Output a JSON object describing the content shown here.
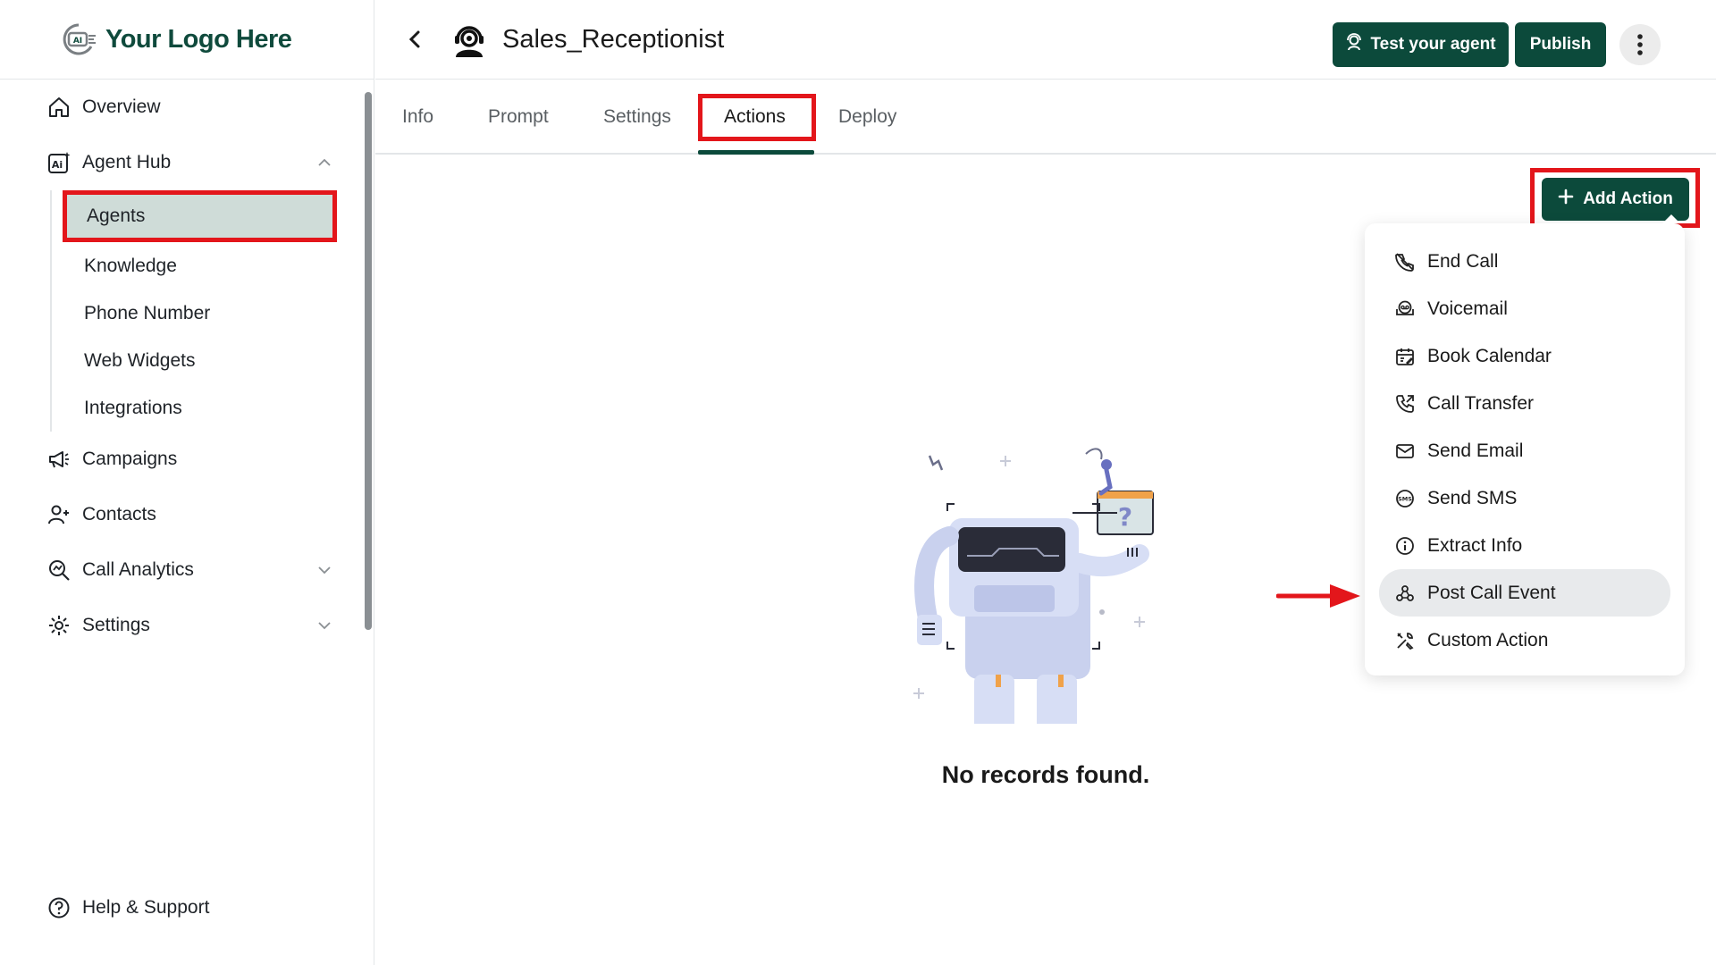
{
  "logo": {
    "text": "Your Logo Here",
    "mark": "AI"
  },
  "sidebar": {
    "items": [
      {
        "label": "Overview",
        "icon": "home-icon"
      },
      {
        "label": "Agent Hub",
        "icon": "ai-spark-icon"
      },
      {
        "label": "Campaigns",
        "icon": "megaphone-icon"
      },
      {
        "label": "Contacts",
        "icon": "user-plus-icon"
      },
      {
        "label": "Call Analytics",
        "icon": "analytics-icon"
      },
      {
        "label": "Settings",
        "icon": "settings-icon"
      }
    ],
    "agent_hub_sub": [
      "Agents",
      "Knowledge",
      "Phone Number",
      "Web Widgets",
      "Integrations"
    ],
    "help": "Help & Support"
  },
  "header": {
    "agent_name": "Sales_Receptionist",
    "test_label": "Test your agent",
    "publish_label": "Publish"
  },
  "tabs": [
    "Info",
    "Prompt",
    "Settings",
    "Actions",
    "Deploy"
  ],
  "active_tab": "Actions",
  "actions": {
    "add_label": "Add Action",
    "menu": [
      {
        "label": "End Call",
        "icon": "end-call-icon"
      },
      {
        "label": "Voicemail",
        "icon": "voicemail-icon"
      },
      {
        "label": "Book Calendar",
        "icon": "calendar-icon"
      },
      {
        "label": "Call Transfer",
        "icon": "call-transfer-icon"
      },
      {
        "label": "Send Email",
        "icon": "email-icon"
      },
      {
        "label": "Send SMS",
        "icon": "sms-icon"
      },
      {
        "label": "Extract Info",
        "icon": "info-icon"
      },
      {
        "label": "Post Call Event",
        "icon": "webhook-icon"
      },
      {
        "label": "Custom Action",
        "icon": "tools-icon"
      }
    ],
    "highlighted_item": "Post Call Event"
  },
  "empty_state": {
    "text": "No records found."
  },
  "colors": {
    "brand": "#0c4a3b",
    "highlight": "#e3161b",
    "active_nav_bg": "#cfdcd8"
  }
}
